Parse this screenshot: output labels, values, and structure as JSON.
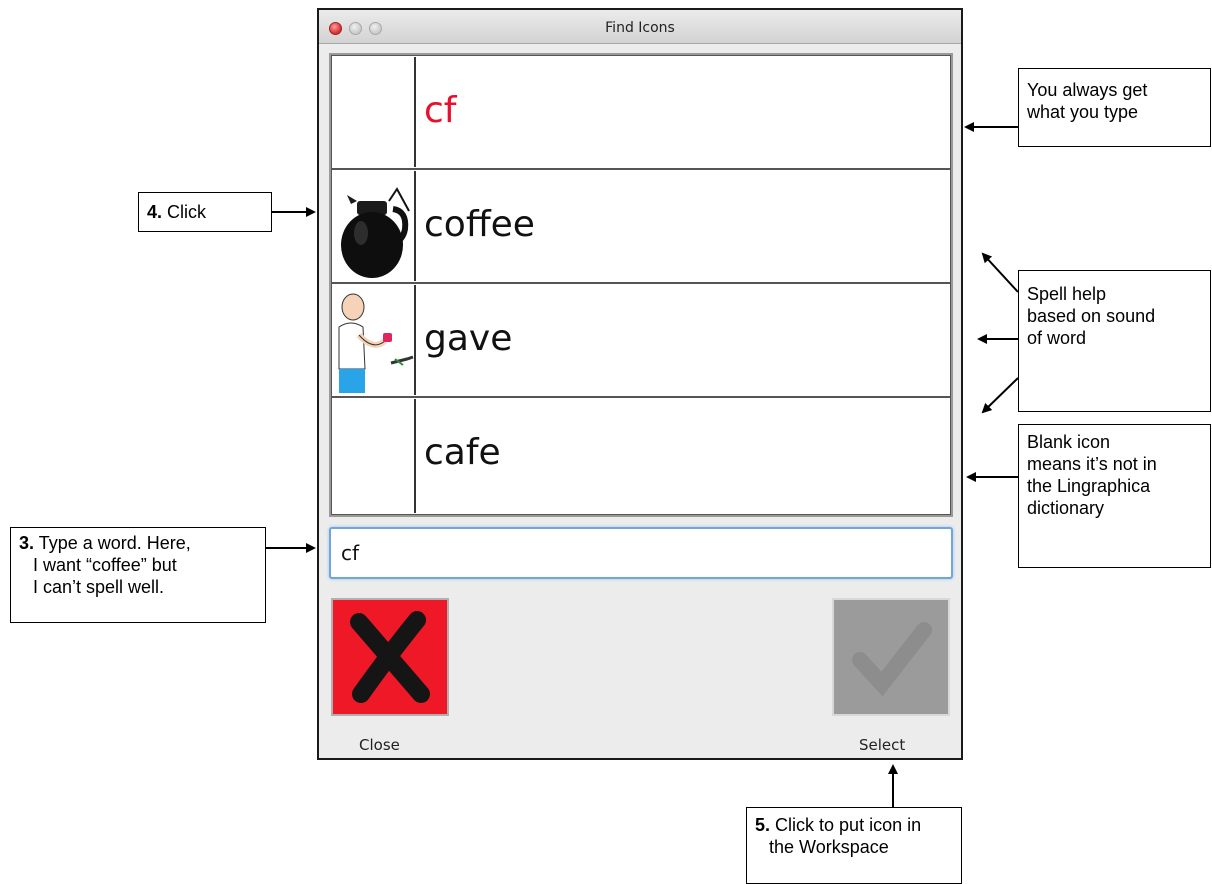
{
  "window": {
    "title": "Find Icons",
    "results": [
      {
        "label": "cf",
        "icon": "blank-icon",
        "typed": true
      },
      {
        "label": "coffee",
        "icon": "coffee-pot-icon",
        "typed": false
      },
      {
        "label": "gave",
        "icon": "person-giving-icon",
        "typed": false
      },
      {
        "label": "cafe",
        "icon": "blank-icon",
        "typed": false
      }
    ],
    "input": {
      "value": "cf"
    },
    "buttons": {
      "close_label": "Close",
      "close_icon": "x-icon",
      "select_label": "Select",
      "select_icon": "check-icon"
    }
  },
  "colors": {
    "typed_text": "#e8102c",
    "close_button": "#ee1826",
    "select_button": "#9b9b9b",
    "input_focus": "#6fa6dc"
  },
  "callouts": {
    "always_get": {
      "line1": "You always get",
      "line2": "what you type"
    },
    "click": {
      "num": "4.",
      "text": "Click"
    },
    "spell_help": {
      "line1": "Spell help",
      "line2": "based on sound",
      "line3": "of word"
    },
    "blank_icon": {
      "line1": "Blank icon",
      "line2": "means it’s not in",
      "line3": "the Lingraphica",
      "line4": "dictionary"
    },
    "type_word": {
      "num": "3.",
      "line1": "Type a word. Here,",
      "line2": "I want “coffee” but",
      "line3": "I can’t spell well."
    },
    "select": {
      "num": "5.",
      "line1": "Click to put icon in",
      "line2": "the Workspace"
    }
  }
}
